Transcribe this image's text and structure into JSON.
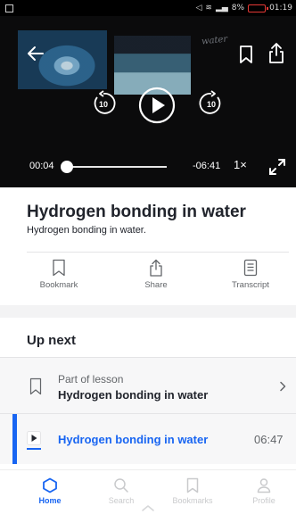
{
  "status_bar": {
    "battery": "8%",
    "time": "01:19"
  },
  "player": {
    "overlay_text": "water",
    "skip_back_seconds": "10",
    "skip_forward_seconds": "10",
    "current_time": "00:04",
    "remaining_time": "-06:41",
    "speed": "1×",
    "progress": 0.01
  },
  "video": {
    "title": "Hydrogen bonding in water",
    "subtitle": "Hydrogen bonding in water."
  },
  "actions": [
    {
      "label": "Bookmark",
      "icon": "bookmark-icon"
    },
    {
      "label": "Share",
      "icon": "share-icon"
    },
    {
      "label": "Transcript",
      "icon": "transcript-icon"
    }
  ],
  "up_next": {
    "heading": "Up next",
    "lesson_part_label": "Part of lesson",
    "lesson_title": "Hydrogen bonding in water",
    "current_item": {
      "title": "Hydrogen bonding in water",
      "duration": "06:47"
    }
  },
  "nav": [
    {
      "label": "Home",
      "icon": "home-icon",
      "active": true
    },
    {
      "label": "Search",
      "icon": "search-icon",
      "active": false
    },
    {
      "label": "Bookmarks",
      "icon": "bookmark-icon",
      "active": false
    },
    {
      "label": "Profile",
      "icon": "profile-icon",
      "active": false
    }
  ],
  "colors": {
    "accent": "#1865f2",
    "text": "#21242c",
    "muted": "#626569"
  }
}
